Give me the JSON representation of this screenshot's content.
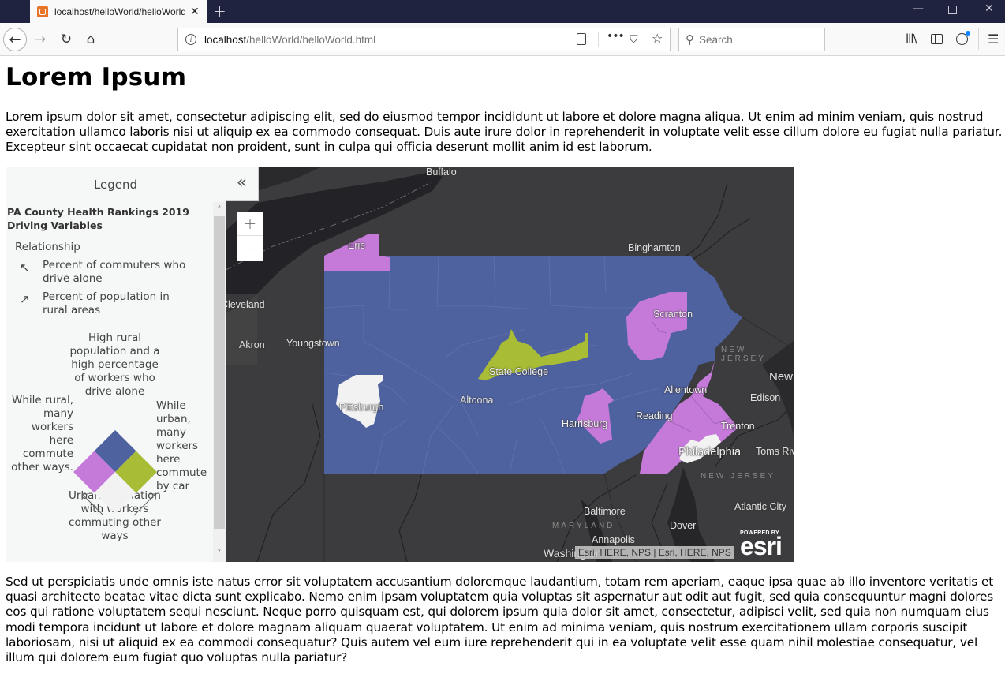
{
  "browser": {
    "tab_title": "localhost/helloWorld/helloWorld.html",
    "tab_close": "✕",
    "new_tab": "+",
    "window_controls": {
      "minimize": "—",
      "maximize": "",
      "close": "✕"
    },
    "nav": {
      "back": "←",
      "forward": "→",
      "reload": "↻",
      "home": "⌂"
    },
    "url": {
      "host": "localhost",
      "path": "/helloWorld/helloWorld.html",
      "info_icon": "i"
    },
    "url_actions": {
      "more": "•••",
      "pocket": "⛉",
      "bookmark": "☆"
    },
    "search_placeholder": "Search",
    "search_icon": "⚲",
    "toolbar": {
      "library": "lll\\",
      "menu": "☰"
    }
  },
  "page": {
    "title": "Lorem Ipsum",
    "paragraph1": "Lorem ipsum dolor sit amet, consectetur adipiscing elit, sed do eiusmod tempor incididunt ut labore et dolore magna aliqua. Ut enim ad minim veniam, quis nostrud exercitation ullamco laboris nisi ut aliquip ex ea commodo consequat. Duis aute irure dolor in reprehenderit in voluptate velit esse cillum dolore eu fugiat nulla pariatur. Excepteur sint occaecat cupidatat non proident, sunt in culpa qui officia deserunt mollit anim id est laborum.",
    "paragraph2": "Sed ut perspiciatis unde omnis iste natus error sit voluptatem accusantium doloremque laudantium, totam rem aperiam, eaque ipsa quae ab illo inventore veritatis et quasi architecto beatae vitae dicta sunt explicabo. Nemo enim ipsam voluptatem quia voluptas sit aspernatur aut odit aut fugit, sed quia consequuntur magni dolores eos qui ratione voluptatem sequi nesciunt. Neque porro quisquam est, qui dolorem ipsum quia dolor sit amet, consectetur, adipisci velit, sed quia non numquam eius modi tempora incidunt ut labore et dolore magnam aliquam quaerat voluptatem. Ut enim ad minima veniam, quis nostrum exercitationem ullam corporis suscipit laboriosam, nisi ut aliquid ex ea commodi consequatur? Quis autem vel eum iure reprehenderit qui in ea voluptate velit esse quam nihil molestiae consequatur, vel illum qui dolorem eum fugiat quo voluptas nulla pariatur?"
  },
  "legend": {
    "title": "Legend",
    "layer_title": "PA County Health Rankings 2019 Driving Variables",
    "relationship_label": "Relationship",
    "variables": [
      {
        "arrow": "↖",
        "label": "Percent of commuters who drive alone"
      },
      {
        "arrow": "↗",
        "label": "Percent of population in rural areas"
      }
    ],
    "quadrants": {
      "top": "High rural population and a high percentage of workers who drive alone",
      "left": "While rural, many workers here commute other ways.",
      "right": "While urban, many workers here commute by car",
      "bottom": "Urban population with workers commuting other ways"
    },
    "colors": {
      "high_high": "#4f62a0",
      "rural_other": "#c57ad9",
      "urban_car": "#a8bd35",
      "low_low": "#f2f2f2"
    },
    "scroll_up": "˄",
    "scroll_down": "˅"
  },
  "map": {
    "collapse_label": "«",
    "zoom_in": "+",
    "zoom_out": "−",
    "cities": [
      "Buffalo",
      "Erie",
      "Binghamton",
      "Cleveland",
      "Akron",
      "Youngstown",
      "Scranton",
      "State College",
      "Pittsburgh",
      "Altoona",
      "Allentown",
      "New",
      "Edison",
      "Harrisburg",
      "Reading",
      "Trenton",
      "Philadelphia",
      "Toms Riv",
      "Baltimore",
      "Dover",
      "Atlantic City",
      "Annapolis",
      "Washington"
    ],
    "state_labels": [
      "NEW JERSEY",
      "NEW JERSEY",
      "MARYLAND"
    ],
    "attribution": "Esri, HERE, NPS | Esri, HERE, NPS",
    "esri_powered": "POWERED BY",
    "esri_word": "esri"
  }
}
